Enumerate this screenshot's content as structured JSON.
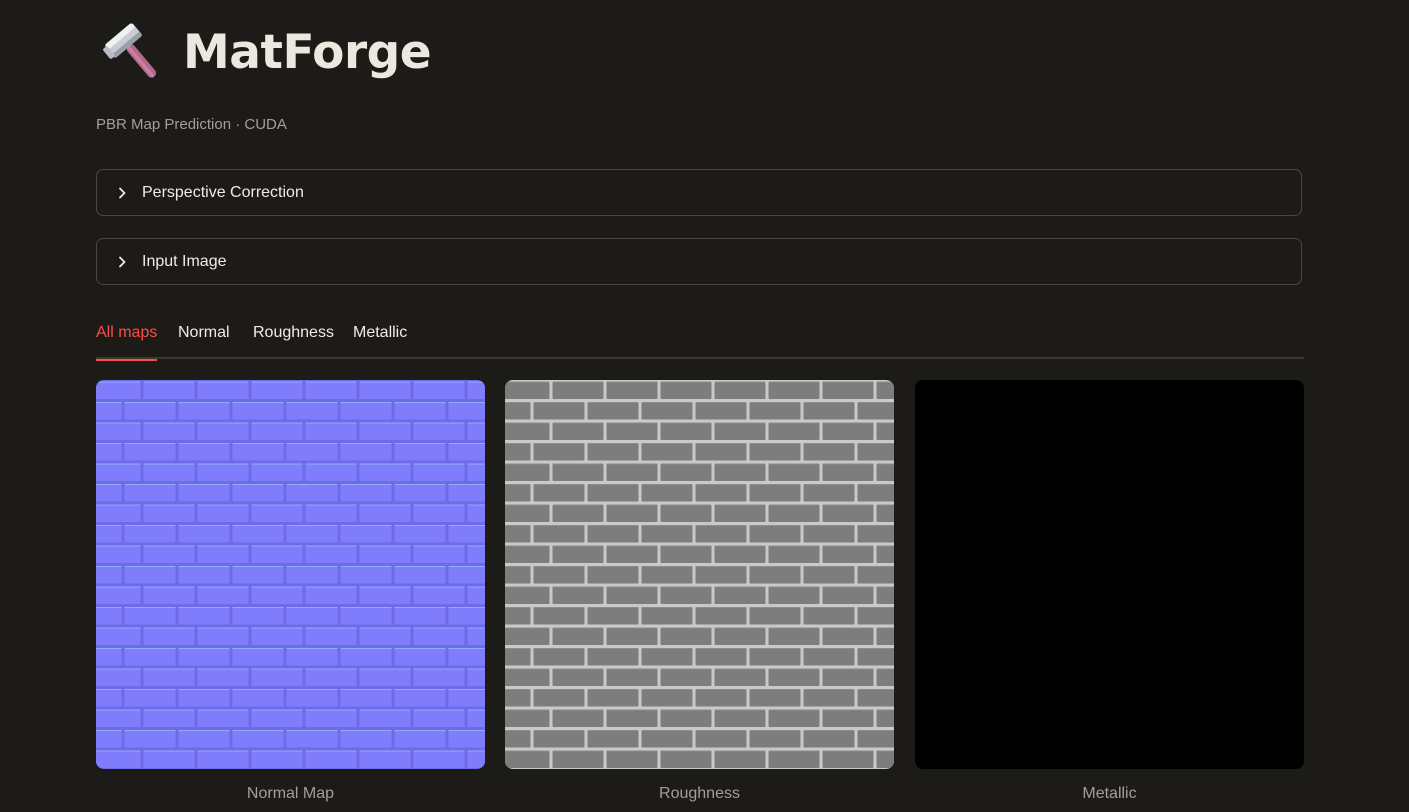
{
  "app": {
    "title": "MatForge",
    "subtitle": "PBR Map Prediction · CUDA",
    "logo_icon": "hammer-icon"
  },
  "expanders": [
    {
      "label": "Perspective Correction",
      "icon": "chevron-right-icon",
      "expanded": false
    },
    {
      "label": "Input Image",
      "icon": "chevron-right-icon",
      "expanded": false
    }
  ],
  "tabs": {
    "items": [
      {
        "label": "All maps",
        "active": true
      },
      {
        "label": "Normal",
        "active": false
      },
      {
        "label": "Roughness",
        "active": false
      },
      {
        "label": "Metallic",
        "active": false
      }
    ],
    "active_color": "#ff4b4b"
  },
  "maps": [
    {
      "caption": "Normal Map",
      "base_color": "#7f7dfb",
      "mortar_color": "#6f6ae8",
      "highlight_color": "#9ad8fb"
    },
    {
      "caption": "Roughness",
      "base_color": "#7d7d7d",
      "mortar_color": "#c9c9c9",
      "highlight_color": "#9a9a9a"
    },
    {
      "caption": "Metallic",
      "base_color": "#000000"
    }
  ]
}
